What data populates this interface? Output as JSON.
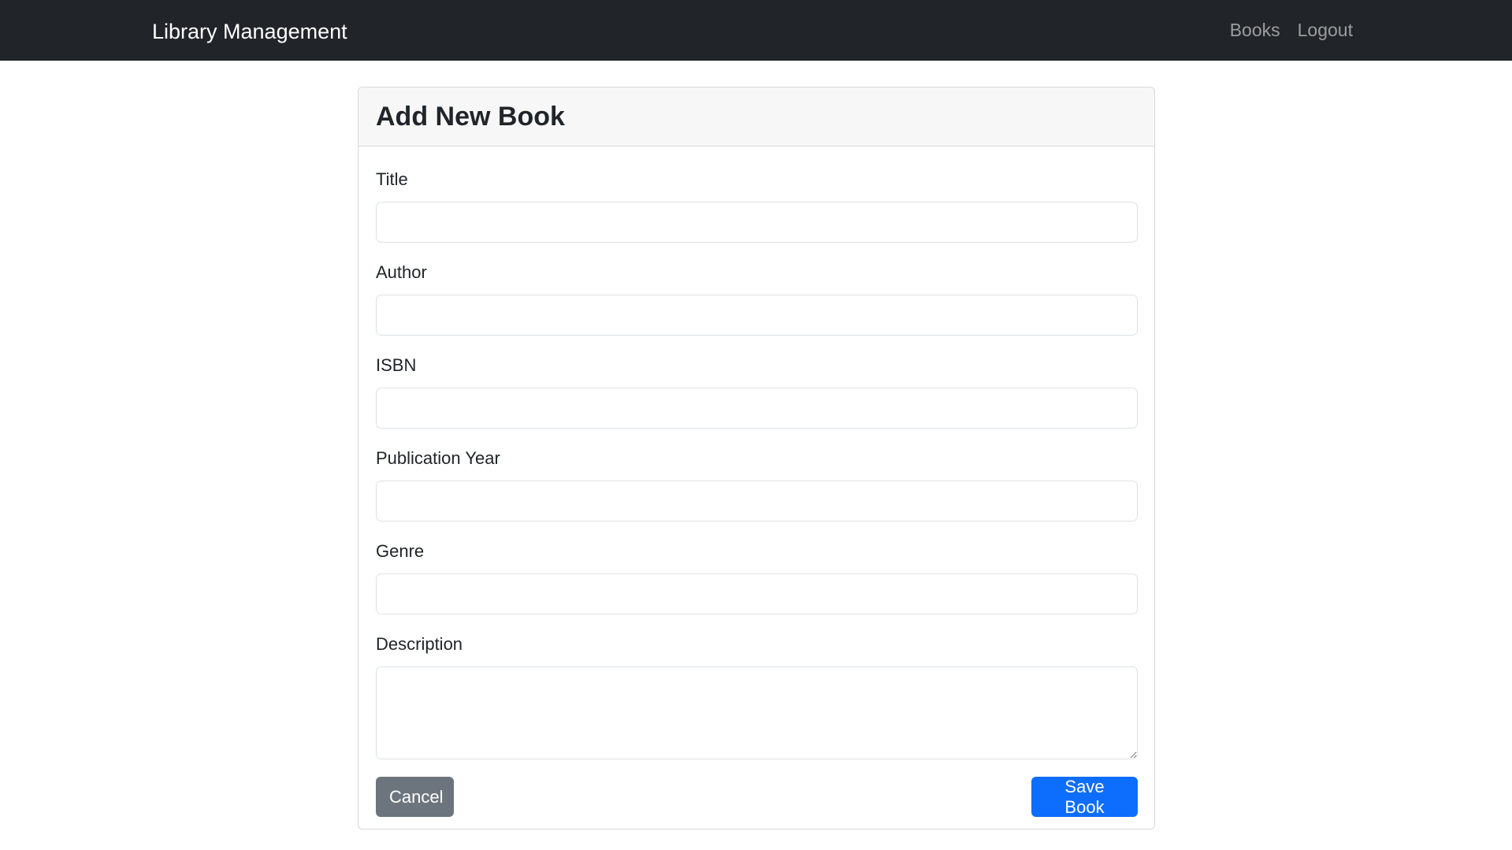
{
  "navbar": {
    "brand": "Library Management",
    "links": [
      "Books",
      "Logout"
    ]
  },
  "form": {
    "title": "Add New Book",
    "fields": {
      "title": {
        "label": "Title",
        "value": ""
      },
      "author": {
        "label": "Author",
        "value": ""
      },
      "isbn": {
        "label": "ISBN",
        "value": ""
      },
      "publication_year": {
        "label": "Publication Year",
        "value": ""
      },
      "genre": {
        "label": "Genre",
        "value": ""
      },
      "description": {
        "label": "Description",
        "value": ""
      }
    },
    "cancel_label": "Cancel",
    "save_label": "Save Book"
  },
  "colors": {
    "navbar_bg": "#212529",
    "primary": "#0d6efd",
    "secondary": "#6c757d"
  }
}
